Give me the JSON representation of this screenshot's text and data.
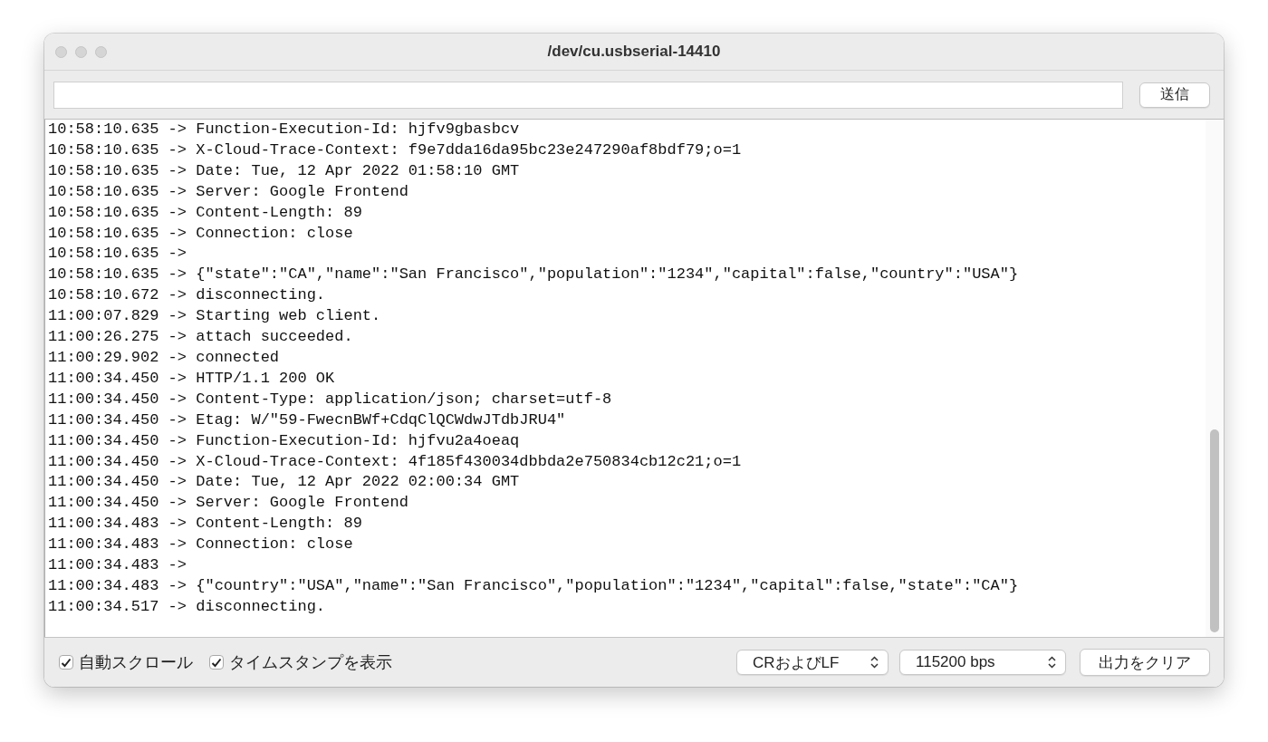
{
  "window": {
    "title": "/dev/cu.usbserial-14410"
  },
  "send_button": "送信",
  "log_lines": [
    "10:58:10.635 -> Function-Execution-Id: hjfv9gbasbcv",
    "10:58:10.635 -> X-Cloud-Trace-Context: f9e7dda16da95bc23e247290af8bdf79;o=1",
    "10:58:10.635 -> Date: Tue, 12 Apr 2022 01:58:10 GMT",
    "10:58:10.635 -> Server: Google Frontend",
    "10:58:10.635 -> Content-Length: 89",
    "10:58:10.635 -> Connection: close",
    "10:58:10.635 ->",
    "10:58:10.635 -> {\"state\":\"CA\",\"name\":\"San Francisco\",\"population\":\"1234\",\"capital\":false,\"country\":\"USA\"}",
    "10:58:10.672 -> disconnecting.",
    "11:00:07.829 -> Starting web client.",
    "11:00:26.275 -> attach succeeded.",
    "11:00:29.902 -> connected",
    "11:00:34.450 -> HTTP/1.1 200 OK",
    "11:00:34.450 -> Content-Type: application/json; charset=utf-8",
    "11:00:34.450 -> Etag: W/\"59-FwecnBWf+CdqClQCWdwJTdbJRU4\"",
    "11:00:34.450 -> Function-Execution-Id: hjfvu2a4oeaq",
    "11:00:34.450 -> X-Cloud-Trace-Context: 4f185f430034dbbda2e750834cb12c21;o=1",
    "11:00:34.450 -> Date: Tue, 12 Apr 2022 02:00:34 GMT",
    "11:00:34.450 -> Server: Google Frontend",
    "11:00:34.483 -> Content-Length: 89",
    "11:00:34.483 -> Connection: close",
    "11:00:34.483 ->",
    "11:00:34.483 -> {\"country\":\"USA\",\"name\":\"San Francisco\",\"population\":\"1234\",\"capital\":false,\"state\":\"CA\"}",
    "11:00:34.517 -> disconnecting."
  ],
  "options": [
    {
      "label": "自動スクロール",
      "checked": true
    },
    {
      "label": "タイムスタンプを表示",
      "checked": true
    }
  ],
  "line_ending_select": "CRおよびLF",
  "baud_rate_select": "115200 bps",
  "clear_button": "出力をクリア"
}
